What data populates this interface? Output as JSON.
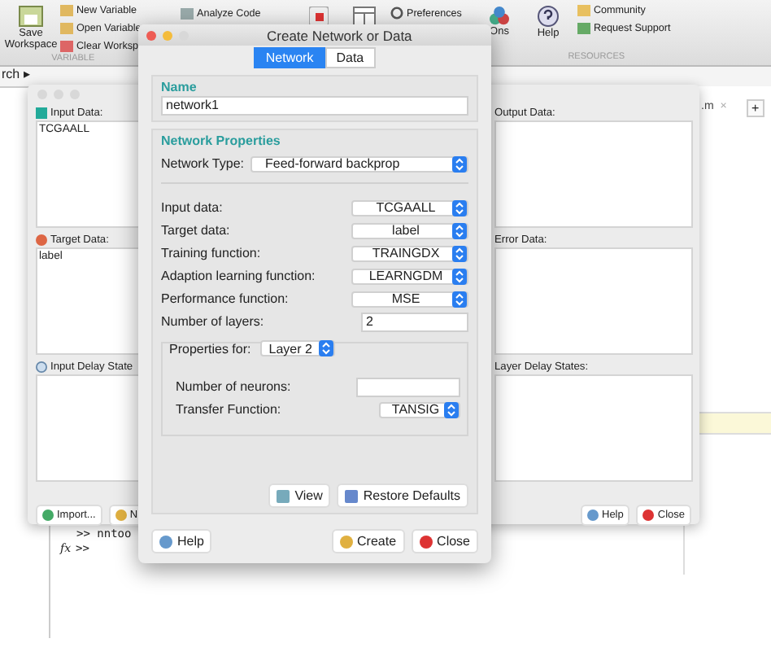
{
  "ribbon": {
    "save_label": "Save Workspace",
    "variable_items": [
      "New Variable",
      "Open Variable",
      "Clear Worksp"
    ],
    "variable_section": "VARIABLE",
    "analyze_code": "Analyze Code",
    "preferences": "Preferences",
    "addons_label": "Ons",
    "help_label": "Help",
    "resource_items": [
      "Community",
      "Request Support"
    ],
    "resources_section": "RESOURCES"
  },
  "address_bar": {
    "text": "rch ▸"
  },
  "editor": {
    "tab": ".m",
    "close": "×",
    "new_tab": "+"
  },
  "command_window": {
    "lines": [
      ">> nntoo"
    ],
    "prompt_icon": "fx",
    "prompt": ">>"
  },
  "nntool": {
    "left_panels": [
      {
        "title": "Input Data:",
        "items": [
          "TCGAALL"
        ]
      },
      {
        "title": "Target Data:",
        "items": [
          "label"
        ]
      },
      {
        "title": "Input Delay State"
      }
    ],
    "right_panels": [
      {
        "title": "Output Data:"
      },
      {
        "title": "Error Data:"
      },
      {
        "title": "Layer Delay States:"
      }
    ],
    "left_buttons": [
      "Import...",
      "N"
    ],
    "right_buttons": [
      "Help",
      "Close"
    ]
  },
  "dialog": {
    "title": "Create Network or Data",
    "tabs": [
      {
        "label": "Network",
        "selected": true
      },
      {
        "label": "Data",
        "selected": false
      }
    ],
    "name_group": {
      "label": "Name",
      "value": "network1"
    },
    "properties": {
      "label": "Network Properties",
      "network_type": {
        "label": "Network Type:",
        "value": "Feed-forward backprop"
      },
      "rows": [
        {
          "kind": "select",
          "label": "Input data:",
          "value": "TCGAALL"
        },
        {
          "kind": "select",
          "label": "Target data:",
          "value": "label"
        },
        {
          "kind": "select",
          "label": "Training function:",
          "value": "TRAINGDX"
        },
        {
          "kind": "select",
          "label": "Adaption learning function:",
          "value": "LEARNGDM"
        },
        {
          "kind": "select",
          "label": "Performance function:",
          "value": "MSE"
        },
        {
          "kind": "field",
          "label": "Number of layers:",
          "value": "2"
        }
      ],
      "layer_group": {
        "label": "Properties for:",
        "value": "Layer 2",
        "rows": [
          {
            "kind": "field",
            "label": "Number of neurons:"
          },
          {
            "kind": "select",
            "label": "Transfer Function:",
            "value": "TANSIG"
          }
        ]
      },
      "buttons": [
        "View",
        "Restore Defaults"
      ]
    },
    "buttons": [
      "Help",
      "Create",
      "Close"
    ]
  }
}
